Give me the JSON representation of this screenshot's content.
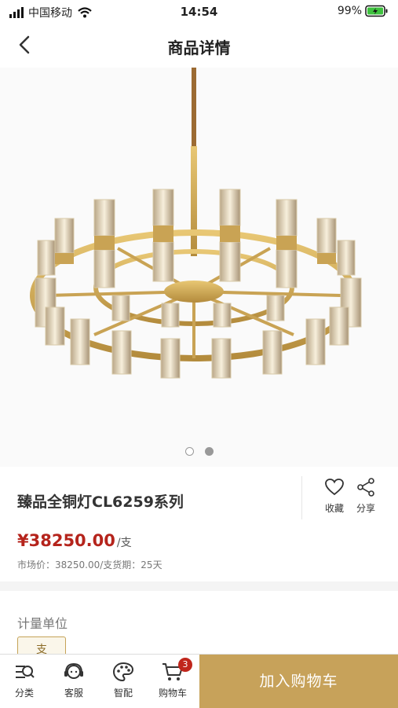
{
  "status_bar": {
    "carrier": "中国移动",
    "time": "14:54",
    "battery": "99%"
  },
  "nav": {
    "title": "商品详情"
  },
  "gallery": {
    "image_count": 2,
    "active_index": 1
  },
  "product": {
    "name": "臻品全铜灯CL6259系列",
    "price": "¥38250.00",
    "price_unit": "/支",
    "meta": "市场价：38250.00/支货期：25天",
    "actions": {
      "favorite_label": "收藏",
      "share_label": "分享"
    }
  },
  "spec": {
    "label": "计量单位",
    "selected_unit": "支"
  },
  "tabbar": {
    "items": [
      {
        "label": "分类",
        "icon": "category-icon"
      },
      {
        "label": "客服",
        "icon": "customer-service-icon"
      },
      {
        "label": "智配",
        "icon": "palette-icon"
      },
      {
        "label": "购物车",
        "icon": "cart-icon",
        "badge": "3"
      }
    ],
    "add_to_cart": "加入购物车"
  },
  "colors": {
    "accent": "#c7a25a",
    "price": "#b5241c"
  }
}
